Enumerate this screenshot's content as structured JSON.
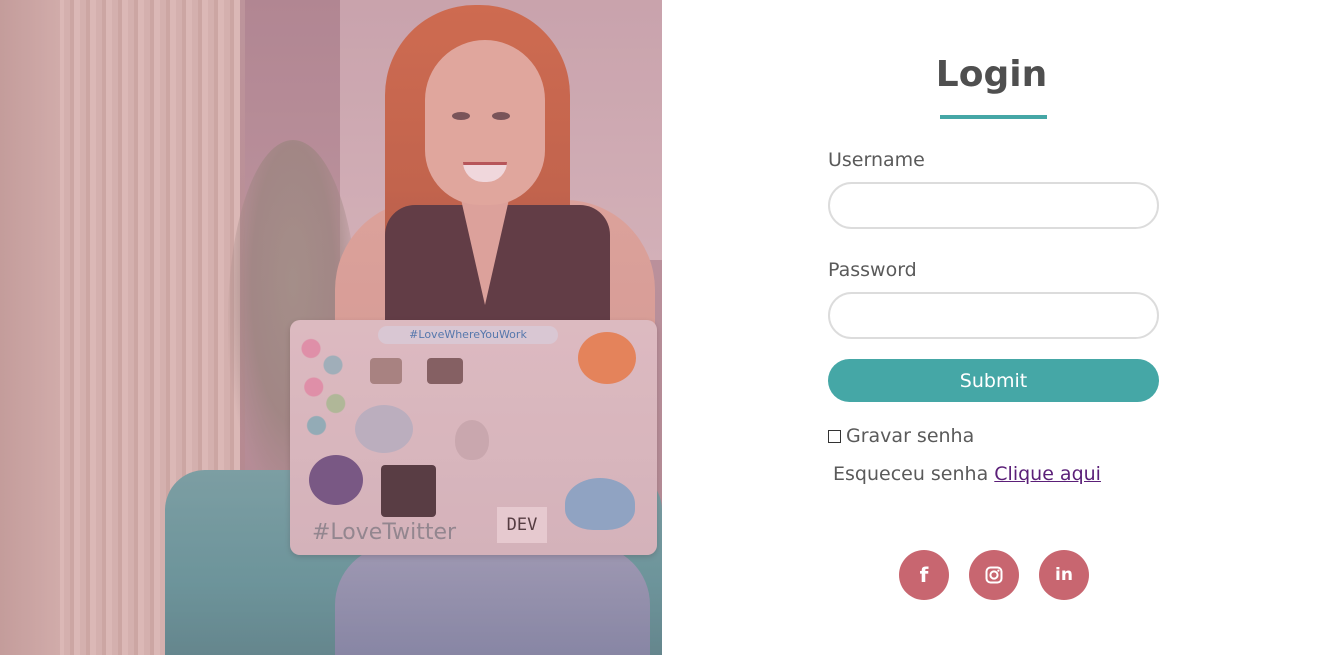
{
  "hero": {
    "laptop_sticker_top": "#LoveWhereYouWork",
    "laptop_sticker_bottom": "#LoveTwitter",
    "laptop_sticker_dev": "DEV"
  },
  "login": {
    "title": "Login",
    "username_label": "Username",
    "username_value": "",
    "password_label": "Password",
    "password_value": "",
    "submit_label": "Submit",
    "remember_label": "Gravar senha",
    "remember_checked": false,
    "forgot_text": "Esqueceu senha",
    "forgot_link": "Clique aqui"
  },
  "social": {
    "items": [
      {
        "icon": "facebook-icon",
        "glyph": "f"
      },
      {
        "icon": "instagram-icon"
      },
      {
        "icon": "linkedin-icon",
        "glyph": "in"
      }
    ],
    "color": "#c86670"
  },
  "colors": {
    "accent": "#45a7a6",
    "link": "#5b1f78",
    "title": "#4f4f4f"
  }
}
